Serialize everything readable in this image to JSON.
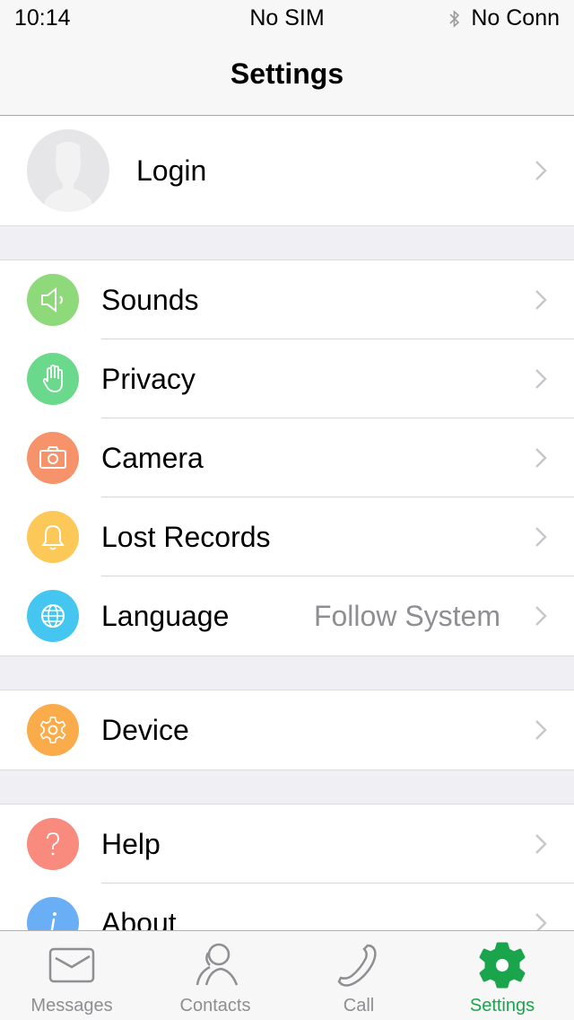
{
  "status_bar": {
    "time": "10:14",
    "carrier": "No SIM",
    "connection": "No Conn",
    "bluetooth_icon": "bluetooth-icon"
  },
  "nav": {
    "title": "Settings"
  },
  "login": {
    "label": "Login",
    "avatar_icon": "person-placeholder-icon"
  },
  "groups": [
    {
      "items": [
        {
          "label": "Sounds",
          "icon": "speaker-icon",
          "color": "#8ed97a",
          "value": ""
        },
        {
          "label": "Privacy",
          "icon": "hand-icon",
          "color": "#6bd98c",
          "value": ""
        },
        {
          "label": "Camera",
          "icon": "camera-icon",
          "color": "#f7936a",
          "value": ""
        },
        {
          "label": "Lost Records",
          "icon": "bell-icon",
          "color": "#fcc858",
          "value": ""
        },
        {
          "label": "Language",
          "icon": "globe-icon",
          "color": "#45c6f0",
          "value": "Follow System"
        }
      ]
    },
    {
      "items": [
        {
          "label": "Device",
          "icon": "gear-icon",
          "color": "#fbac4a",
          "value": ""
        }
      ]
    },
    {
      "items": [
        {
          "label": "Help",
          "icon": "question-icon",
          "color": "#f98a7e",
          "value": ""
        },
        {
          "label": "About",
          "icon": "info-icon",
          "color": "#6aaef5",
          "value": ""
        }
      ]
    }
  ],
  "tabs": [
    {
      "label": "Messages",
      "icon": "envelope-icon",
      "active": false
    },
    {
      "label": "Contacts",
      "icon": "contacts-icon",
      "active": false
    },
    {
      "label": "Call",
      "icon": "phone-icon",
      "active": false
    },
    {
      "label": "Settings",
      "icon": "gear-icon",
      "active": true
    }
  ],
  "colors": {
    "accent": "#1aa54c",
    "secondary_text": "#8e8e93",
    "chevron": "#c7c7cc"
  }
}
